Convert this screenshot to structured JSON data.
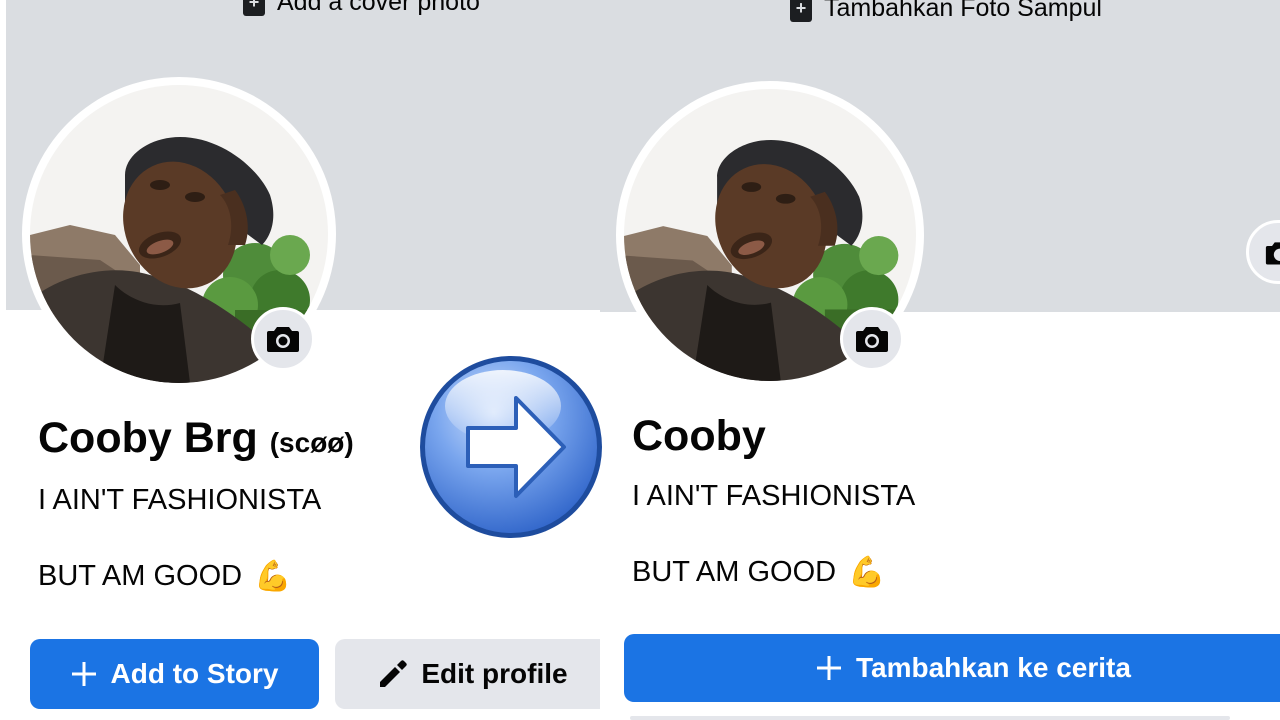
{
  "left_profile": {
    "cover_action": "Add a cover photo",
    "name": "Cooby Brg",
    "alternate_name": "(scøø)",
    "bio_line1": "I AIN'T FASHIONISTA",
    "bio_line2": "BUT AM GOOD",
    "bio_emoji": "💪",
    "add_story_label": "Add to Story",
    "edit_profile_label": "Edit profile"
  },
  "right_profile": {
    "cover_action": "Tambahkan Foto Sampul",
    "name": "Cooby",
    "bio_line1": "I AIN'T FASHIONISTA",
    "bio_line2": "BUT AM GOOD",
    "bio_emoji": "💪",
    "add_story_label": "Tambahkan ke cerita"
  },
  "icons": {
    "cover": "add-photo-icon",
    "camera": "camera-icon",
    "plus": "plus-icon",
    "pencil": "pencil-icon",
    "arrow": "right-arrow-icon"
  },
  "colors": {
    "cover_bg": "#dadde1",
    "primary_blue": "#1b74e4",
    "secondary_grey": "#e4e6eb",
    "arrow_blue": "#4f86e6"
  }
}
